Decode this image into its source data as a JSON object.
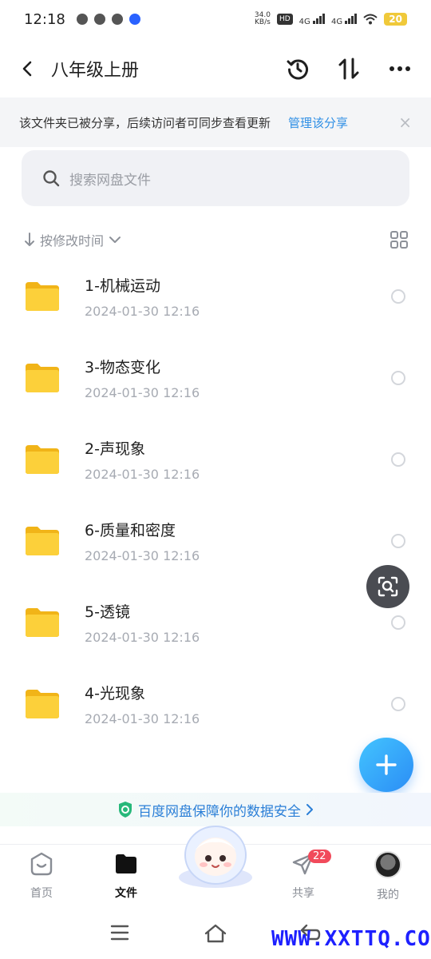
{
  "status_bar": {
    "time": "12:18",
    "net_speed_value": "34.0",
    "net_speed_unit": "KB/s",
    "hd_badge": "HD",
    "signal1": "4G",
    "signal2": "4G",
    "battery": "20"
  },
  "header": {
    "title": "八年级上册",
    "icons": [
      "back-icon",
      "history-icon",
      "sort-swap-icon",
      "more-icon"
    ]
  },
  "notice": {
    "text": "该文件夹已被分享，后续访问者可同步查看更新",
    "link": "管理该分享",
    "close": "×"
  },
  "search": {
    "placeholder": "搜索网盘文件"
  },
  "sort": {
    "label": "按修改时间"
  },
  "files": [
    {
      "name": "1-机械运动",
      "date": "2024-01-30  12:16"
    },
    {
      "name": "3-物态变化",
      "date": "2024-01-30  12:16"
    },
    {
      "name": "2-声现象",
      "date": "2024-01-30  12:16"
    },
    {
      "name": "6-质量和密度",
      "date": "2024-01-30  12:16"
    },
    {
      "name": "5-透镜",
      "date": "2024-01-30  12:16"
    },
    {
      "name": "4-光现象",
      "date": "2024-01-30  12:16"
    }
  ],
  "safety_banner": {
    "text": "百度网盘保障你的数据安全"
  },
  "tabs": [
    {
      "label": "首页"
    },
    {
      "label": "文件"
    },
    {
      "label": "共享",
      "badge": "22"
    },
    {
      "label": "我的"
    }
  ],
  "watermark": "WWW.XXTTQ.COM",
  "colors": {
    "accent": "#2f8fe5",
    "folder": "#f9c62b",
    "badge": "#f14a5b"
  }
}
